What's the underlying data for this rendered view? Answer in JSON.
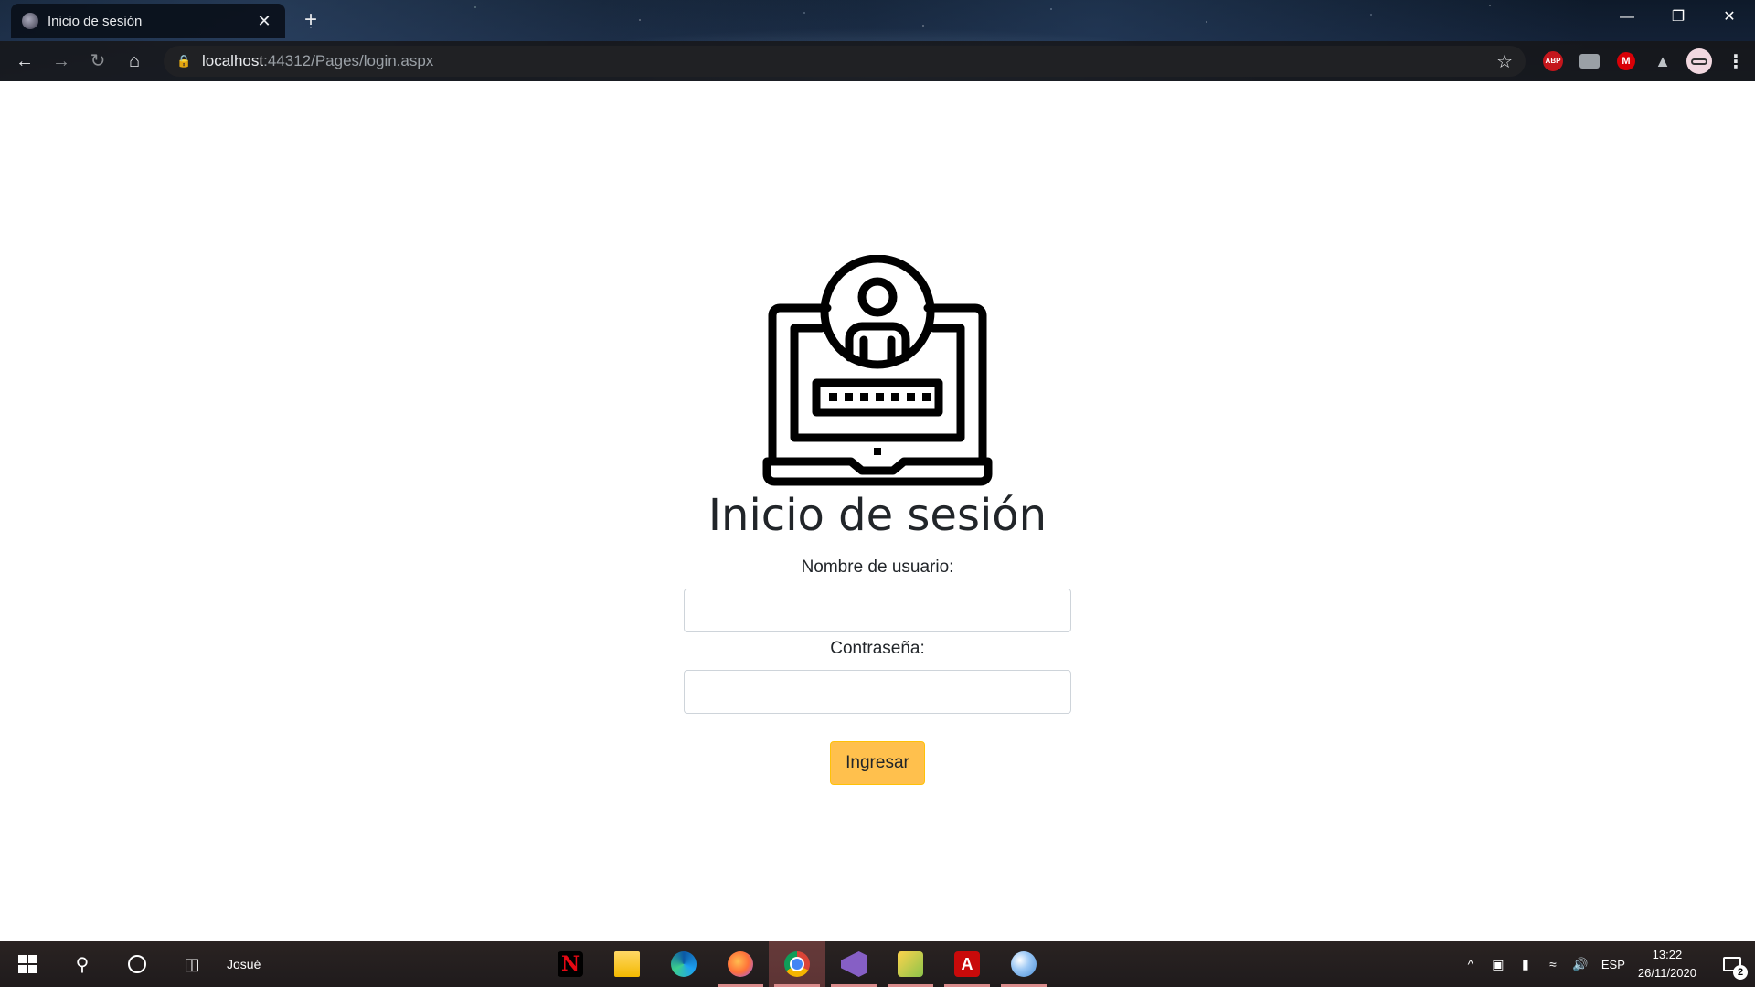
{
  "browser": {
    "tab_title": "Inicio de sesión",
    "tab_close": "✕",
    "new_tab": "+",
    "url_host": "localhost",
    "url_path": ":44312/Pages/login.aspx",
    "extensions": {
      "adblock_label": "ABP",
      "mega_label": "M"
    }
  },
  "login": {
    "title": "Inicio de sesión",
    "username_label": "Nombre de usuario:",
    "username_value": "",
    "password_label": "Contraseña:",
    "password_value": "",
    "submit_label": "Ingresar",
    "submit_color": "#ffc04d",
    "password_mask_dots": 7
  },
  "taskbar": {
    "user": "Josué",
    "apps": [
      "netflix",
      "file-explorer",
      "edge",
      "firefox",
      "chrome",
      "visual-studio",
      "sticky-notes",
      "acrobat",
      "paint"
    ],
    "netflix_glyph": "N",
    "acrobat_glyph": "A",
    "language": "ESP",
    "time": "13:22",
    "date": "26/11/2020",
    "notification_count": "2"
  }
}
